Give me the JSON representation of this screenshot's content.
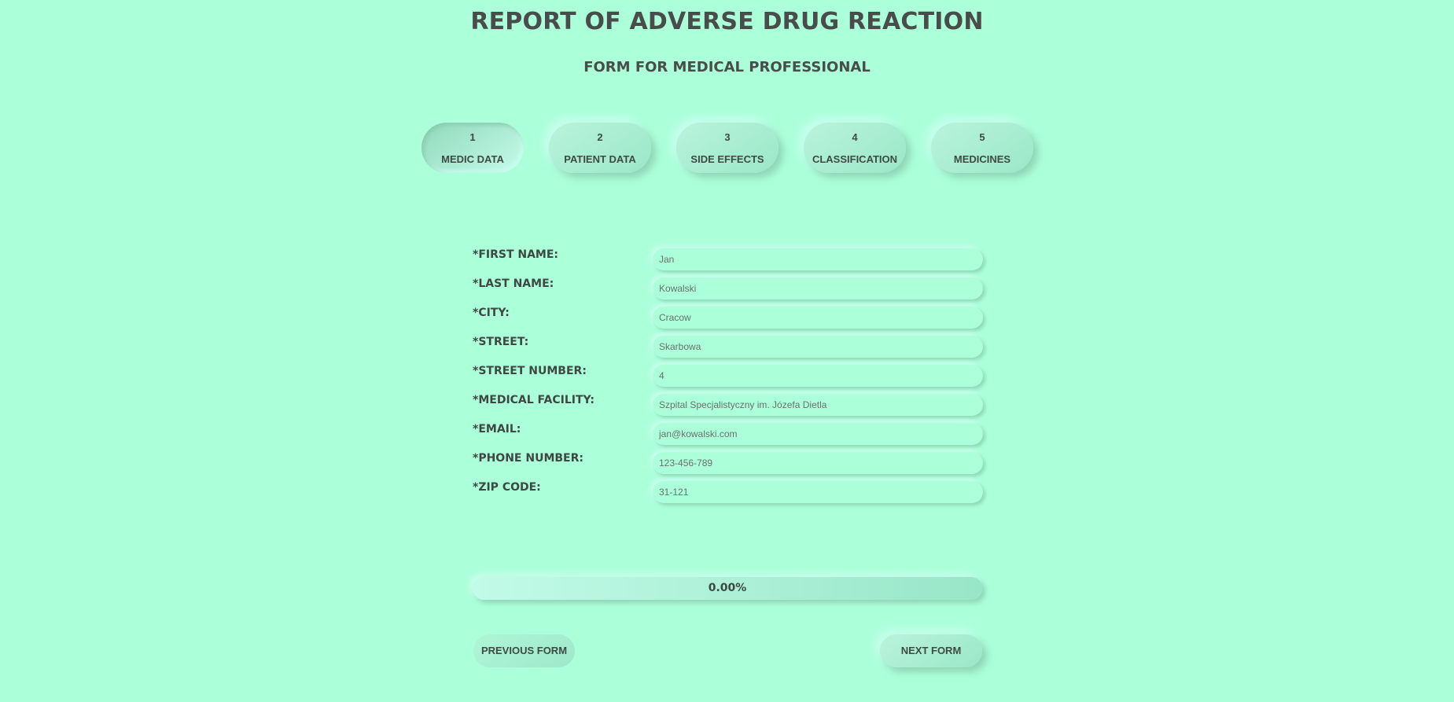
{
  "header": {
    "title": "REPORT OF ADVERSE DRUG REACTION",
    "subtitle": "FORM FOR MEDICAL PROFESSIONAL"
  },
  "steps": [
    {
      "number": "1",
      "label": "MEDIC DATA",
      "active": true
    },
    {
      "number": "2",
      "label": "PATIENT DATA"
    },
    {
      "number": "3",
      "label": "SIDE EFFECTS"
    },
    {
      "number": "4",
      "label": "CLASSIFICATION"
    },
    {
      "number": "5",
      "label": "MEDICINES"
    }
  ],
  "form": {
    "fields": [
      {
        "label": "*FIRST NAME:",
        "value": "Jan"
      },
      {
        "label": "*LAST NAME:",
        "value": "Kowalski"
      },
      {
        "label": "*CITY:",
        "value": "Cracow"
      },
      {
        "label": "*STREET:",
        "value": "Skarbowa"
      },
      {
        "label": "*STREET NUMBER:",
        "value": "4"
      },
      {
        "label": "*MEDICAL FACILITY:",
        "value": "Szpital Specjalistyczny im. Józefa Dietla"
      },
      {
        "label": "*EMAIL:",
        "value": "jan@kowalski.com"
      },
      {
        "label": "*PHONE NUMBER:",
        "value": "123-456-789"
      },
      {
        "label": "*ZIP CODE:",
        "value": "31-121"
      }
    ]
  },
  "progress": {
    "text": "0.00%",
    "value": 0
  },
  "nav": {
    "previous_label": "PREVIOUS FORM",
    "next_label": "NEXT FORM"
  },
  "colors": {
    "background": "#abffd9",
    "text": "#4a4c4b"
  }
}
